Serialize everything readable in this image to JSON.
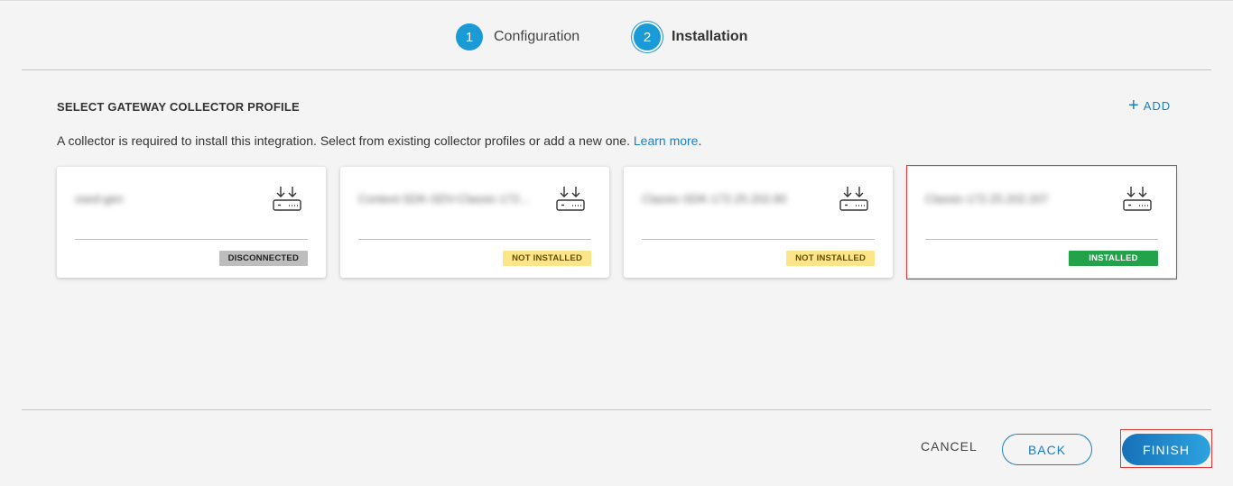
{
  "stepper": {
    "steps": [
      {
        "number": "1",
        "label": "Configuration"
      },
      {
        "number": "2",
        "label": "Installation"
      }
    ]
  },
  "section": {
    "title": "SELECT GATEWAY COLLECTOR PROFILE",
    "add_label": "ADD",
    "add_icon": "plus-icon",
    "description": "A collector is required to install this integration. Select from existing collector profiles or add a new one.",
    "learn_more": "Learn more",
    "description_end": "."
  },
  "collectors": [
    {
      "name": "ssed-gen",
      "status": "DISCONNECTED",
      "icon": "gateway-collector-icon"
    },
    {
      "name": "Context-SDK-SDV-Classic-172...",
      "status": "NOT INSTALLED",
      "icon": "gateway-collector-icon"
    },
    {
      "name": "Classic-SDK-172.25.202.80",
      "status": "NOT INSTALLED",
      "icon": "gateway-collector-icon"
    },
    {
      "name": "Classic-172.25.202.207",
      "status": "INSTALLED",
      "icon": "gateway-collector-icon"
    }
  ],
  "footer": {
    "cancel": "CANCEL",
    "back": "BACK",
    "finish": "FINISH"
  },
  "colors": {
    "accent": "#1a9ad6",
    "installed": "#22a34a",
    "not_installed": "#fde58a",
    "disconnected": "#bdbdbd",
    "highlight": "#e53935"
  }
}
